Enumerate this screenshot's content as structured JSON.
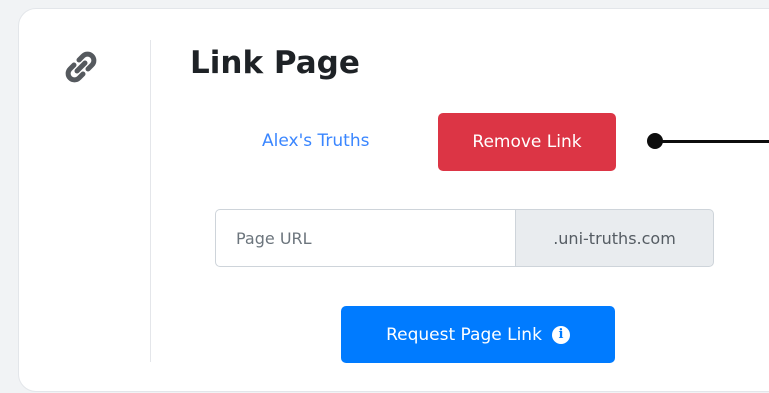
{
  "card": {
    "title": "Link Page",
    "icon": "link-icon"
  },
  "linked_page": {
    "name": "Alex's Truths"
  },
  "actions": {
    "remove_label": "Remove Link",
    "request_label": "Request Page Link",
    "request_icon": "info-icon"
  },
  "url_input": {
    "placeholder": "Page URL",
    "value": "",
    "suffix": ".uni-truths.com"
  },
  "colors": {
    "danger": "#dc3545",
    "primary": "#007bff",
    "link": "#3a86ff",
    "addon_bg": "#e9ecef"
  }
}
